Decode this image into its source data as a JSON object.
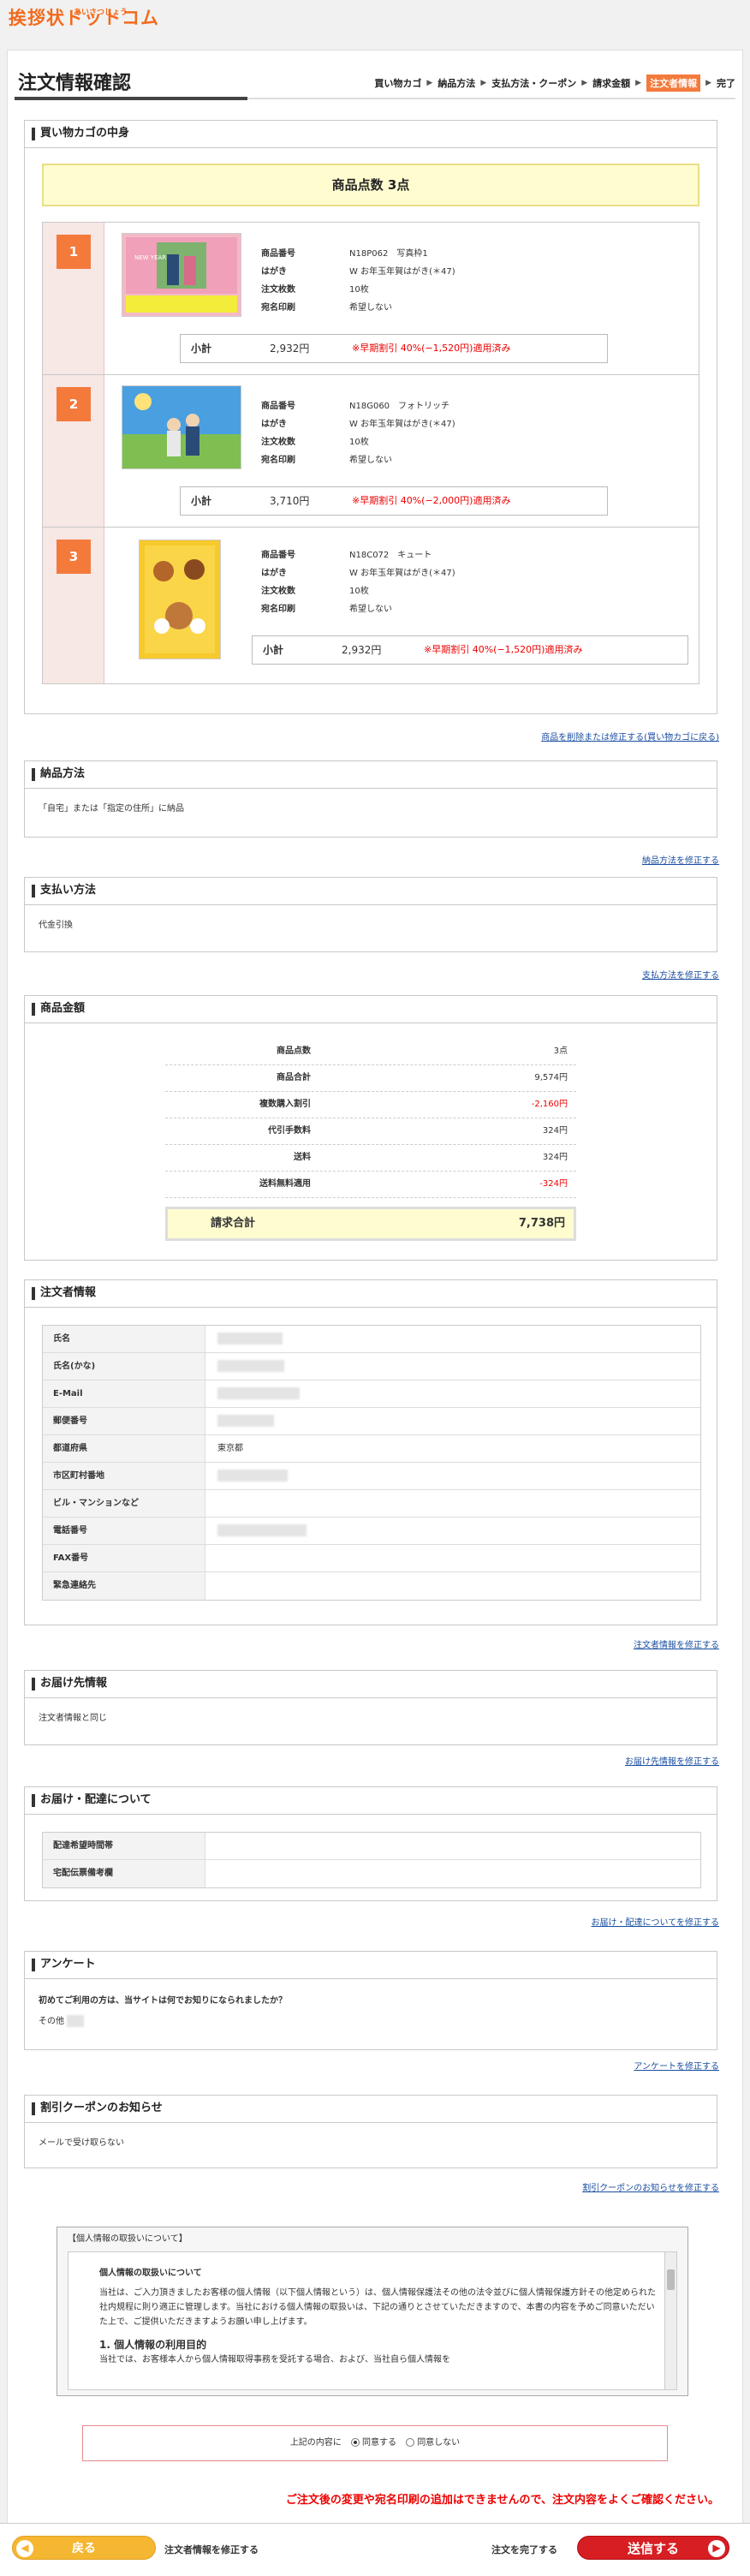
{
  "logo": {
    "text": "挨拶状ドットコム",
    "sub": "あいさつじょう"
  },
  "header": {
    "title": "注文情報確認",
    "steps": [
      "買い物カゴ",
      "納品方法",
      "支払方法・クーポン",
      "請求金額",
      "注文者情報",
      "完了"
    ],
    "current_step": "注文者情報"
  },
  "cart": {
    "title": "買い物カゴの中身",
    "count_label": "商品点数",
    "count_value": "3点",
    "fix_link": "商品を削除または修正する(買い物カゴに戻る)",
    "labels": {
      "product_no": "商品番号",
      "postcard": "はがき",
      "qty": "注文枚数",
      "address_print": "宛名印刷",
      "subtotal": "小計"
    },
    "items": [
      {
        "num": "1",
        "product_no": "N18P062",
        "product_name": "写真枠1",
        "postcard": "W お年玉年賀はがき(＊47)",
        "qty": "10枚",
        "address_print": "希望しない",
        "subtotal": "2,932円",
        "discount": "※早期割引 40%(−1,520円)適用済み"
      },
      {
        "num": "2",
        "product_no": "N18G060",
        "product_name": "フォトリッチ",
        "postcard": "W お年玉年賀はがき(＊47)",
        "qty": "10枚",
        "address_print": "希望しない",
        "subtotal": "3,710円",
        "discount": "※早期割引 40%(−2,000円)適用済み"
      },
      {
        "num": "3",
        "product_no": "N18C072",
        "product_name": "キュート",
        "postcard": "W お年玉年賀はがき(＊47)",
        "qty": "10枚",
        "address_print": "希望しない",
        "subtotal": "2,932円",
        "discount": "※早期割引 40%(−1,520円)適用済み"
      }
    ]
  },
  "delivery": {
    "title": "納品方法",
    "value": "「自宅」または「指定の住所」に納品",
    "fix_link": "納品方法を修正する"
  },
  "payment": {
    "title": "支払い方法",
    "value": "代金引換",
    "fix_link": "支払方法を修正する"
  },
  "price": {
    "title": "商品金額",
    "rows": [
      {
        "label": "商品点数",
        "value": "3点",
        "red": false
      },
      {
        "label": "商品合計",
        "value": "9,574円",
        "red": false
      },
      {
        "label": "複数購入割引",
        "value": "-2,160円",
        "red": true
      },
      {
        "label": "代引手数料",
        "value": "324円",
        "red": false
      },
      {
        "label": "送料",
        "value": "324円",
        "red": false
      },
      {
        "label": "送料無料適用",
        "value": "-324円",
        "red": true
      }
    ],
    "total_label": "請求合計",
    "total_value": "7,738円"
  },
  "orderer": {
    "title": "注文者情報",
    "rows": [
      {
        "label": "氏名",
        "value": ""
      },
      {
        "label": "氏名(かな)",
        "value": ""
      },
      {
        "label": "E-Mail",
        "value": ""
      },
      {
        "label": "郵便番号",
        "value": ""
      },
      {
        "label": "都道府県",
        "value": "東京都"
      },
      {
        "label": "市区町村番地",
        "value": ""
      },
      {
        "label": "ビル・マンションなど",
        "value": ""
      },
      {
        "label": "電話番号",
        "value": ""
      },
      {
        "label": "FAX番号",
        "value": ""
      },
      {
        "label": "緊急連絡先",
        "value": ""
      }
    ],
    "fix_link": "注文者情報を修正する"
  },
  "shipping": {
    "title": "お届け先情報",
    "value": "注文者情報と同じ",
    "fix_link": "お届け先情報を修正する"
  },
  "delivery_time": {
    "title": "お届け・配達について",
    "rows": [
      {
        "label": "配達希望時間帯",
        "value": ""
      },
      {
        "label": "宅配伝票備考欄",
        "value": ""
      }
    ],
    "fix_link": "お届け・配達についてを修正する"
  },
  "survey": {
    "title": "アンケート",
    "question": "初めてご利用の方は、当サイトは何でお知りになられましたか？",
    "answer": "その他",
    "fix_link": "アンケートを修正する"
  },
  "coupon": {
    "title": "割引クーポンのお知らせ",
    "value": "メールで受け取らない",
    "fix_link": "割引クーポンのお知らせを修正する"
  },
  "privacy": {
    "header": "【個人情報の取扱いについて】",
    "heading": "個人情報の取扱いについて",
    "body": "当社は、ご入力頂きましたお客様の個人情報（以下個人情報という）は、個人情報保護法その他の法令並びに個人情報保護方針その他定められた社内規程に則り適正に管理します。当社における個人情報の取扱いは、下記の通りとさせていただきますので、本書の内容を予めご同意いただいた上で、ご提供いただきますようお願い申し上げます。",
    "section1": "1. 個人情報の利用目的",
    "section1_body": "当社では、お客様本人から個人情報取得事務を受託する場合、および、当社自ら個人情報を"
  },
  "agree": {
    "label": "上記の内容に",
    "opt_yes": "同意する",
    "opt_no": "同意しない"
  },
  "warning": "ご注文後の変更や宛名印刷の追加はできませんので、注文内容をよくご確認ください。",
  "footer": {
    "back": "戻る",
    "back_caption": "注文者情報を修正する",
    "send_caption": "注文を完了する",
    "send": "送信する"
  }
}
